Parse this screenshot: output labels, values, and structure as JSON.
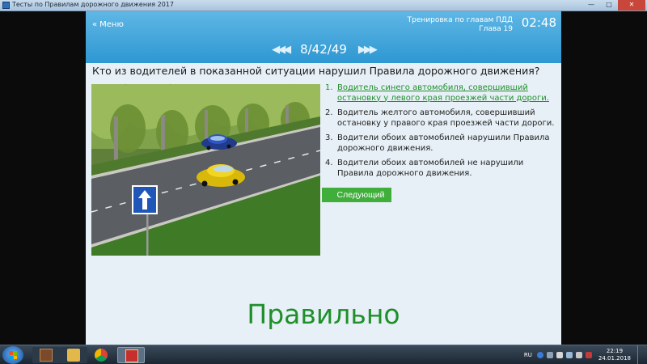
{
  "window": {
    "title": "Тесты по Правилам дорожного движения 2017"
  },
  "header": {
    "menu_label": "Меню",
    "mode_line1": "Тренировка по главам ПДД",
    "mode_line2": "Глава 19",
    "timer": "02:48",
    "pager": "8/42/49"
  },
  "question": {
    "text": "Кто из водителей в показанной ситуации нарушил Правила дорожного движения?"
  },
  "answers": [
    {
      "num": "1.",
      "text": "Водитель синего автомобиля, совершивший остановку у левого края проезжей части дороги.",
      "state": "correct"
    },
    {
      "num": "2.",
      "text": "Водитель желтого автомобиля, совершивший остановку у правого края проезжей части дороги.",
      "state": "normal"
    },
    {
      "num": "3.",
      "text": "Водители обоих автомобилей нарушили Правила дорожного движения.",
      "state": "normal"
    },
    {
      "num": "4.",
      "text": "Водители обоих автомобилей не нарушили Правила дорожного движения.",
      "state": "normal"
    }
  ],
  "next_button": "Следующий",
  "result": "Правильно",
  "scene": {
    "icons": [
      "blue-car-icon",
      "yellow-car-icon",
      "one-way-sign-icon"
    ]
  },
  "taskbar": {
    "language": "RU",
    "time": "22:19",
    "date": "24.01.2018"
  },
  "colors": {
    "header_blue": "#2e97d2",
    "correct_green": "#1f8f2a",
    "button_green": "#3fae3a",
    "panel_bg": "#e7f0f6"
  }
}
